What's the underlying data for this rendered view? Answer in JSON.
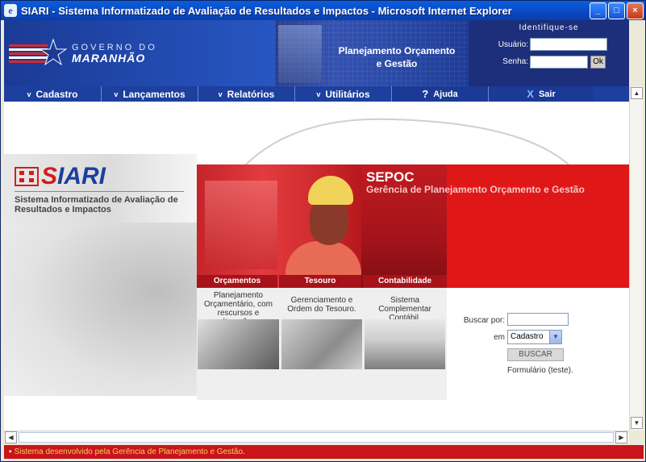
{
  "window": {
    "title": "SIARI - Sistema Informatizado de Avaliação de Resultados e Impactos - Microsoft Internet Explorer",
    "buttons": {
      "minimize": "_",
      "maximize": "□",
      "close": "×"
    }
  },
  "header": {
    "gov_line1": "GOVERNO DO",
    "gov_line2": "MARANHÃO",
    "caption": "Planejamento Orçamento e Gestão",
    "login": {
      "title": "Identifique-se",
      "user_label": "Usuário:",
      "password_label": "Senha:",
      "ok_label": "Ok"
    }
  },
  "menu": {
    "items": [
      {
        "label": "Cadastro",
        "icon": "chevron-down-icon",
        "glyph": "v"
      },
      {
        "label": "Lançamentos",
        "icon": "chevron-down-icon",
        "glyph": "v"
      },
      {
        "label": "Relatórios",
        "icon": "chevron-down-icon",
        "glyph": "v"
      },
      {
        "label": "Utilitários",
        "icon": "chevron-down-icon",
        "glyph": "v"
      },
      {
        "label": "Ajuda",
        "icon": "help-icon",
        "glyph": "?"
      },
      {
        "label": "Sair",
        "icon": "close-icon",
        "glyph": "X"
      }
    ]
  },
  "siari": {
    "logo": "SIARI",
    "description": "Sistema Informatizado de Avaliação de Resultados e Impactos"
  },
  "sepoc": {
    "title": "SEPOC",
    "subtitle": "Gerência de Planejamento Orçamento e Gestão"
  },
  "modules": [
    {
      "tab": "Orçamentos",
      "description": "Planejamento Orçamentário, com rescursos e alterações."
    },
    {
      "tab": "Tesouro",
      "description": "Gerenciamento e Ordem do Tesouro."
    },
    {
      "tab": "Contabilidade",
      "description": "Sistema Complementar Contábil."
    }
  ],
  "search": {
    "label": "Buscar por:",
    "in_label": "em",
    "selected": "Cadastro",
    "button": "BUSCAR",
    "form_link": "Formulário (teste)."
  },
  "status": {
    "text": "Sistema desenvolvido pela Gerência de Planejamento e Gestão."
  },
  "colors": {
    "title_bar": "#0b4fcf",
    "header_blue": "#1d3f9e",
    "accent_red": "#e01717",
    "status_red": "#c9141b"
  }
}
